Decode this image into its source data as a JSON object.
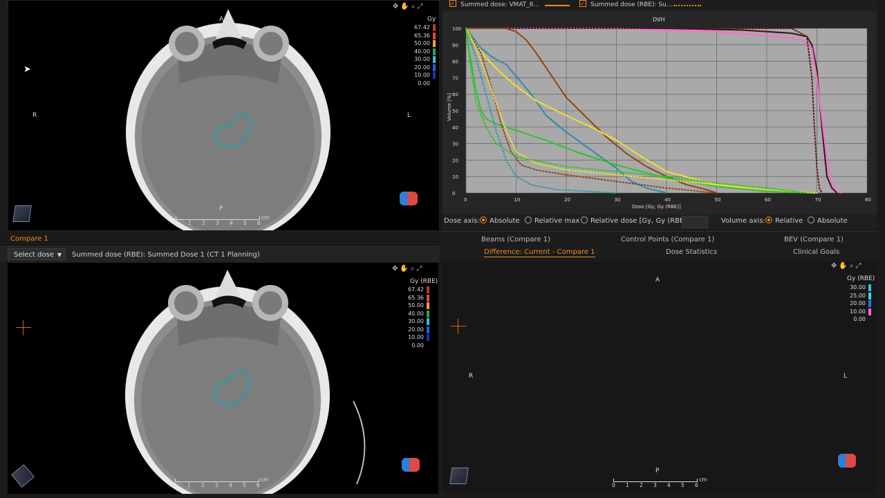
{
  "top_view": {
    "orient_top": "A",
    "orient_bottom": "P",
    "orient_left": "R",
    "orient_right": "L",
    "dose_unit": "Gy",
    "dose_legend": [
      {
        "value": "67.42",
        "color": "#c0392b"
      },
      {
        "value": "65.36",
        "color": "#e0483e"
      },
      {
        "value": "50.00",
        "color": "#f0a22e"
      },
      {
        "value": "40.00",
        "color": "#2e9e5e"
      },
      {
        "value": "30.00",
        "color": "#2ec2e0"
      },
      {
        "value": "20.00",
        "color": "#2e5be0"
      },
      {
        "value": "10.00",
        "color": "#1b2fb0"
      },
      {
        "value": "0.00",
        "color": ""
      }
    ],
    "scale_ticks": [
      "0",
      "1",
      "2",
      "3",
      "4",
      "5",
      "6"
    ],
    "scale_unit": "cm"
  },
  "compare_tab": {
    "label": "Compare 1"
  },
  "select_dose": {
    "label": "Select dose",
    "caption": "Summed dose (RBE): Summed Dose 1 (CT 1 Planning)"
  },
  "bottom_view": {
    "dose_unit": "Gy (RBE)",
    "dose_legend": [
      {
        "value": "67.42",
        "color": "#c0392b"
      },
      {
        "value": "65.36",
        "color": "#e0483e"
      },
      {
        "value": "50.00",
        "color": "#f0a22e"
      },
      {
        "value": "40.00",
        "color": "#2e9e5e"
      },
      {
        "value": "30.00",
        "color": "#2ec2e0"
      },
      {
        "value": "20.00",
        "color": "#2e5be0"
      },
      {
        "value": "10.00",
        "color": "#1b2fb0"
      },
      {
        "value": "0.00",
        "color": ""
      }
    ],
    "scale_ticks": [
      "0",
      "1",
      "2",
      "3",
      "4",
      "5",
      "6"
    ],
    "scale_unit": "cm"
  },
  "dvh_header": {
    "item1": "Summed dose: VMAT_6...",
    "item2": "Summed dose (RBE): Su..."
  },
  "chart_data": {
    "type": "line",
    "title": "DVH",
    "xlabel": "Dose [Gy, Gy (RBE)]",
    "ylabel": "Volume [%]",
    "xlim": [
      0,
      80
    ],
    "ylim": [
      0,
      100
    ],
    "x_ticks": [
      "0",
      "10",
      "20",
      "30",
      "40",
      "50",
      "60",
      "70",
      "80"
    ],
    "y_ticks": [
      "0",
      "10",
      "20",
      "30",
      "40",
      "50",
      "60",
      "70",
      "80",
      "90",
      "100"
    ],
    "grid": true,
    "series": [
      {
        "color": "#3b0f12",
        "style": "solid",
        "x": [
          0,
          5,
          10,
          20,
          40,
          55,
          65,
          68,
          69,
          70,
          71,
          72,
          73,
          74
        ],
        "y": [
          100,
          100,
          100,
          100,
          100,
          99,
          97,
          95,
          90,
          75,
          40,
          10,
          3,
          0
        ]
      },
      {
        "color": "#ff69d4",
        "style": "solid",
        "x": [
          0,
          10,
          30,
          50,
          62,
          67,
          69,
          70,
          71,
          72,
          73,
          74,
          75
        ],
        "y": [
          100,
          100,
          100,
          98,
          95,
          93,
          88,
          70,
          45,
          20,
          6,
          1,
          0
        ]
      },
      {
        "color": "#5a1015",
        "style": "dotted",
        "x": [
          0,
          10,
          30,
          50,
          65,
          68,
          69,
          69.5,
          70,
          70.5,
          71
        ],
        "y": [
          100,
          100,
          100,
          100,
          100,
          95,
          70,
          40,
          15,
          3,
          0
        ]
      },
      {
        "color": "#8b4513",
        "style": "solid",
        "x": [
          0,
          8,
          10,
          12,
          14,
          16,
          18,
          20,
          24,
          28,
          32,
          36,
          40,
          44,
          48,
          50
        ],
        "y": [
          100,
          100,
          98,
          93,
          85,
          76,
          67,
          58,
          46,
          34,
          24,
          16,
          10,
          5,
          2,
          0
        ]
      },
      {
        "color": "#2e8aa6",
        "style": "solid",
        "x": [
          0,
          2,
          3,
          5,
          8,
          10,
          13,
          16,
          20,
          25,
          30,
          33,
          36,
          40
        ],
        "y": [
          100,
          92,
          88,
          83,
          78,
          71,
          60,
          47,
          37,
          26,
          15,
          7,
          3,
          0
        ]
      },
      {
        "color": "#f0e030",
        "style": "solid",
        "x": [
          0,
          2,
          4,
          6,
          8,
          10,
          14,
          20,
          25,
          30,
          35,
          40,
          50,
          60,
          70
        ],
        "y": [
          100,
          90,
          82,
          76,
          70,
          65,
          56,
          47,
          40,
          32,
          22,
          13,
          5,
          1,
          0
        ]
      },
      {
        "color": "#2ec22e",
        "style": "solid",
        "x": [
          0,
          1,
          2,
          3,
          4,
          6,
          10,
          16,
          22,
          30,
          40,
          50,
          60,
          70
        ],
        "y": [
          100,
          80,
          62,
          50,
          45,
          42,
          38,
          32,
          25,
          17,
          9,
          4,
          1,
          0
        ]
      },
      {
        "color": "#2e9aa6",
        "style": "dotted",
        "x": [
          0,
          2,
          4,
          6,
          8,
          10,
          13,
          18,
          24,
          30
        ],
        "y": [
          100,
          82,
          60,
          38,
          20,
          10,
          5,
          2,
          1,
          0
        ]
      },
      {
        "color": "#8b4513",
        "style": "dotted",
        "x": [
          0,
          3,
          5,
          7,
          9,
          11,
          14,
          20,
          30,
          40,
          50
        ],
        "y": [
          100,
          85,
          65,
          42,
          25,
          17,
          14,
          11,
          7,
          3,
          0
        ]
      },
      {
        "color": "#f0e030",
        "style": "dotted",
        "x": [
          0,
          2,
          4,
          6,
          8,
          10,
          14,
          20,
          30,
          40,
          50,
          60,
          70
        ],
        "y": [
          100,
          88,
          72,
          55,
          38,
          25,
          18,
          14,
          11,
          8,
          5,
          2,
          0
        ]
      },
      {
        "color": "#2ec22e",
        "style": "dotted",
        "x": [
          0,
          1,
          2,
          4,
          6,
          10,
          20,
          30,
          40,
          50,
          60,
          68
        ],
        "y": [
          100,
          75,
          55,
          40,
          30,
          22,
          16,
          13,
          10,
          6,
          3,
          0
        ]
      }
    ]
  },
  "axis_options": {
    "dose_axis_label": "Dose axis:",
    "absolute": "Absolute",
    "relative_max": "Relative max",
    "relative_dose": "Relative dose [Gy, Gy (RBE)]:",
    "relative_dose_value": "",
    "volume_axis_label": "Volume axis:",
    "relative": "Relative",
    "absolute2": "Absolute"
  },
  "tabs_row1": [
    "Beams (Compare 1)",
    "Control Points (Compare 1)",
    "BEV (Compare 1)"
  ],
  "tabs_row2": [
    "Difference: Current - Compare 1",
    "Dose Statistics",
    "Clinical Goals"
  ],
  "diff_view": {
    "orient_top": "A",
    "orient_bottom": "P",
    "orient_left": "R",
    "orient_right": "L",
    "dose_unit": "Gy (RBE)",
    "dose_legend": [
      {
        "value": "30.00",
        "color": "#2ec2e0"
      },
      {
        "value": "25.00",
        "color": "#2ee0e0"
      },
      {
        "value": "20.00",
        "color": "#3070e0"
      },
      {
        "value": "10.00",
        "color": "#ff69d4"
      },
      {
        "value": "0.00",
        "color": ""
      }
    ],
    "scale_ticks": [
      "0",
      "1",
      "2",
      "3",
      "4",
      "5",
      "6"
    ],
    "scale_unit": "cm"
  }
}
